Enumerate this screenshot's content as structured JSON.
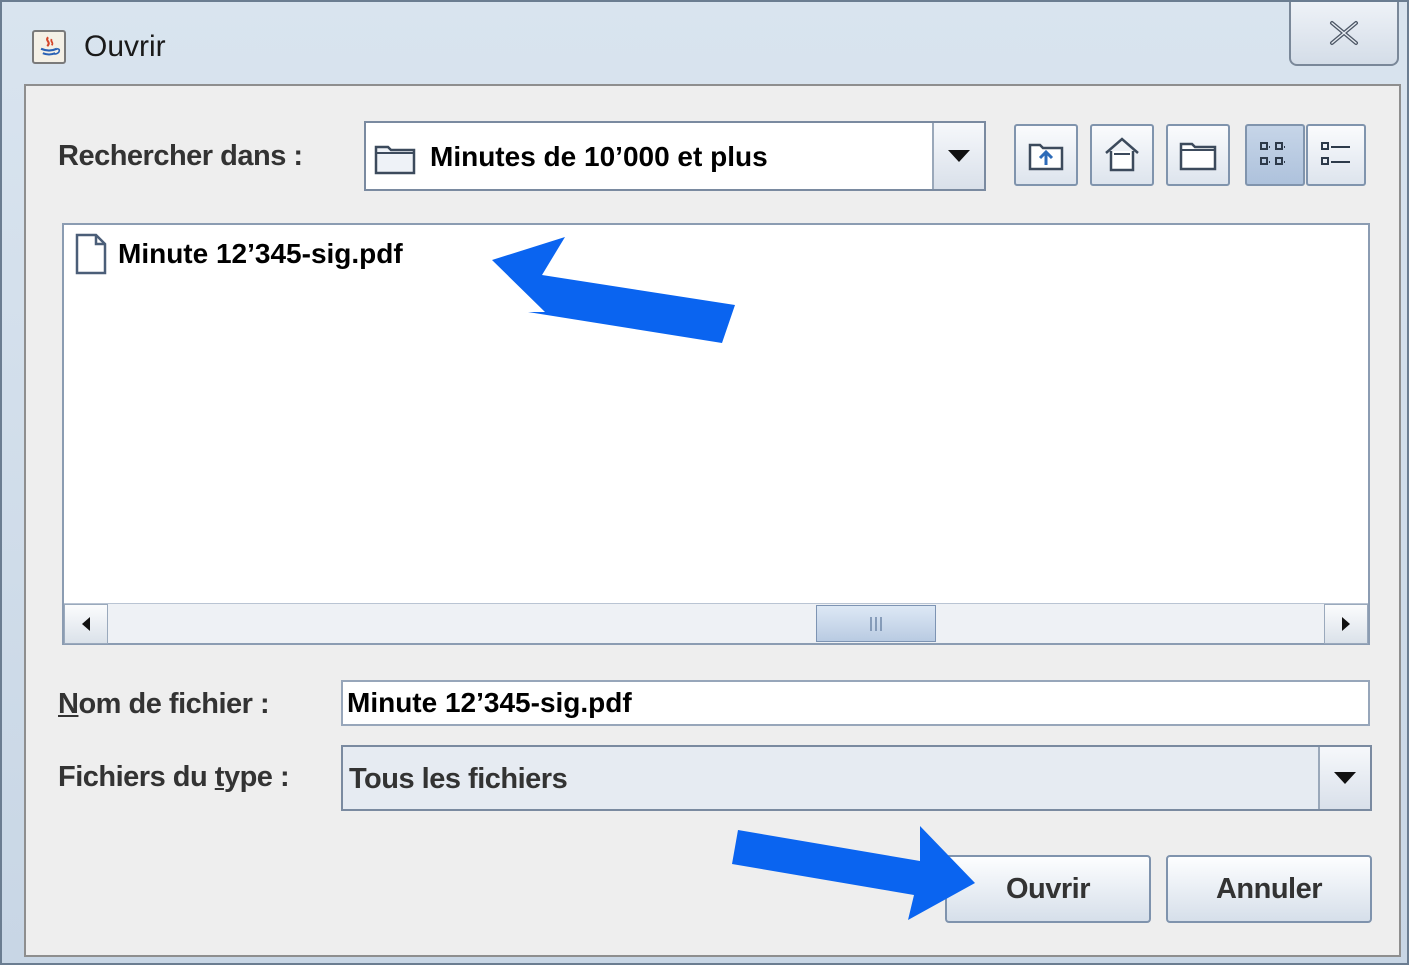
{
  "window": {
    "title": "Ouvrir"
  },
  "lookin": {
    "label": "Rechercher dans :",
    "value": "Minutes de 10’000 et plus"
  },
  "toolbar": {
    "icons": [
      "up-one-level-icon",
      "home-icon",
      "new-folder-icon",
      "list-view-icon",
      "details-view-icon"
    ]
  },
  "files": [
    {
      "name": "Minute 12’345-sig.pdf",
      "icon": "file-icon"
    }
  ],
  "filename": {
    "label_mnemonic": "N",
    "label_rest": "om de fichier :",
    "value": "Minute 12’345-sig.pdf"
  },
  "filetype": {
    "label_pre": "Fichiers du ",
    "label_mnemonic": "t",
    "label_post": "ype :",
    "value": "Tous les fichiers"
  },
  "buttons": {
    "open": "Ouvrir",
    "cancel": "Annuler"
  },
  "colors": {
    "annotation_arrow": "#0a64f0",
    "window_frame": "#c8d6e5",
    "client_bg": "#eeeeee"
  }
}
